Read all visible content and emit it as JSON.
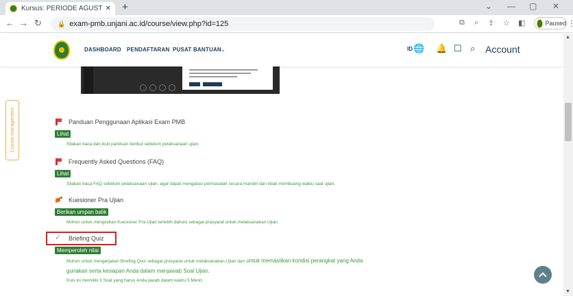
{
  "browser": {
    "tab_title": "Kursus: PERIODE AGUSTUS (GEL",
    "tab_close": "✕",
    "new_tab": "+",
    "url": "exam-pmb.unjani.ac.id/course/view.php?id=125",
    "profile_label": "Paused",
    "window_controls": [
      "⌄",
      "—",
      "▢",
      "✕"
    ]
  },
  "navbar": {
    "links": [
      "DASHBOARD",
      "PENDAFTARAN",
      "PUSAT BANTUAN"
    ],
    "language": "ID",
    "account": "Account"
  },
  "side_tab": {
    "label": "Course management"
  },
  "activities": [
    {
      "icon": "pdf-icon",
      "name": "Panduan Penggunaan Aplikasi Exam PMB",
      "button": "Lihat",
      "description": "Silakan baca dan ikuti panduan berikut sebelum pelaksanaan ujian."
    },
    {
      "icon": "pdf-icon",
      "name": "Frequently Asked Questions (FAQ)",
      "button": "Lihat",
      "description": "Silakan baca FAQ sebelum pelaksanaan ujian, agar dapat mengatasi permasalah secara mandiri dan tidak membuang waktu saat ujian."
    },
    {
      "icon": "feedback-icon",
      "name": "Kuesioner Pra Ujian",
      "button": "Berikan umpan balik",
      "description": "Mohon untuk mengisikan Kuesioner Pra Ujian terlebih dahulu sebagai prasyarat untuk melaksanakan Ujian."
    },
    {
      "icon": "quiz-icon",
      "name": "Briefing Quiz",
      "button": "Memperoleh nilai",
      "description_small_1": "Mohon untuk mengerjakan Briefing Quiz sebagai prasyarat untuk melaksanakan Ujian dan",
      "description_big_1": "untuk memastikan kondisi perangkat yang Anda",
      "description_big_2": "gunakan serta kesiapan Anda dalam menjawab Soal Ujian.",
      "description_2": "Kuis ini memiliki 3 Soal yang harus Anda jawab dalam waktu 5 Menit."
    }
  ],
  "colors": {
    "brand_green": "#2e7d32",
    "nav_text": "#1a3c5a",
    "highlight_red": "#e01b1b",
    "side_tab_orange": "#f0ad4e"
  }
}
